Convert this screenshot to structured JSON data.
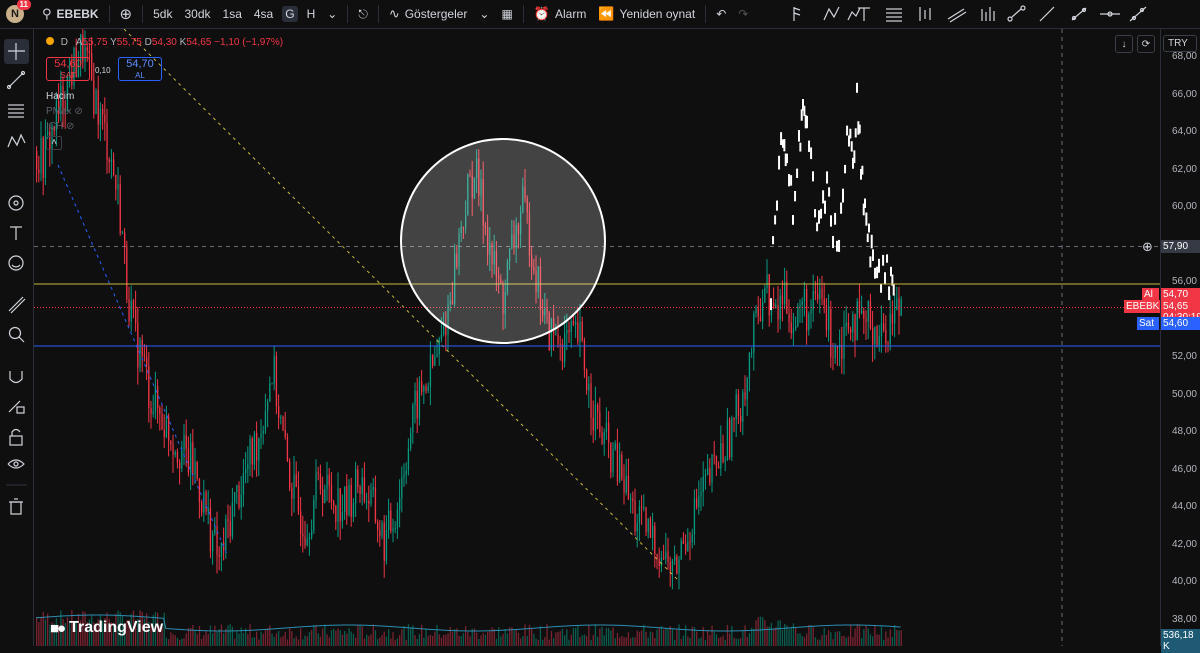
{
  "topbar": {
    "avatar_letter": "N",
    "notification_count": "11",
    "symbol": "EBEBK",
    "intervals": [
      "5dk",
      "30dk",
      "1sa",
      "4sa",
      "G",
      "H"
    ],
    "selected_interval": "G",
    "indicators_label": "Göstergeler",
    "alert_label": "Alarm",
    "replay_label": "Yeniden oynat"
  },
  "legend": {
    "interval": "D",
    "open_label": "A",
    "open": "55,75",
    "high_label": "Y",
    "high": "55,75",
    "low_label": "D",
    "low": "54,30",
    "close_label": "K",
    "close": "54,65",
    "change": "−1,10 (−1,97%)"
  },
  "trade": {
    "sell_price": "54,60",
    "sell_label": "SAT",
    "spread": "0,10",
    "buy_price": "54,70",
    "buy_label": "AL"
  },
  "studies": [
    "Hacim",
    "PMax",
    "ICH"
  ],
  "chart_data": {
    "type": "candlestick",
    "symbol": "EBEBK",
    "currency": "TRY",
    "y_ticks": [
      38,
      40,
      42,
      44,
      46,
      48,
      50,
      52,
      54,
      56,
      58,
      60,
      62,
      64,
      66,
      68
    ],
    "ylim": [
      36.6,
      69.5
    ],
    "last_price": 54.65,
    "countdown": "04:30:19",
    "crosshair_price": 57.9,
    "ask": 54.7,
    "bid": 54.6,
    "horizontal_levels": [
      {
        "price": 55.9,
        "color": "#c8b93a"
      },
      {
        "price": 52.6,
        "color": "#2962ff"
      }
    ],
    "volume_last": "536,18 K"
  },
  "price_tags": {
    "crosshair": "57,90",
    "ask_label": "Al",
    "ask": "54,70",
    "symbol": "EBEBK",
    "last": "54,65",
    "countdown": "04:30:19",
    "bid_label": "Sat",
    "bid": "54,60",
    "volume": "536,18 K"
  },
  "currency": "TRY",
  "brand": "TradingView",
  "colors": {
    "up": "#089981",
    "down": "#f23645",
    "highlight": "#ffffff",
    "bg": "#0f0f0f"
  }
}
